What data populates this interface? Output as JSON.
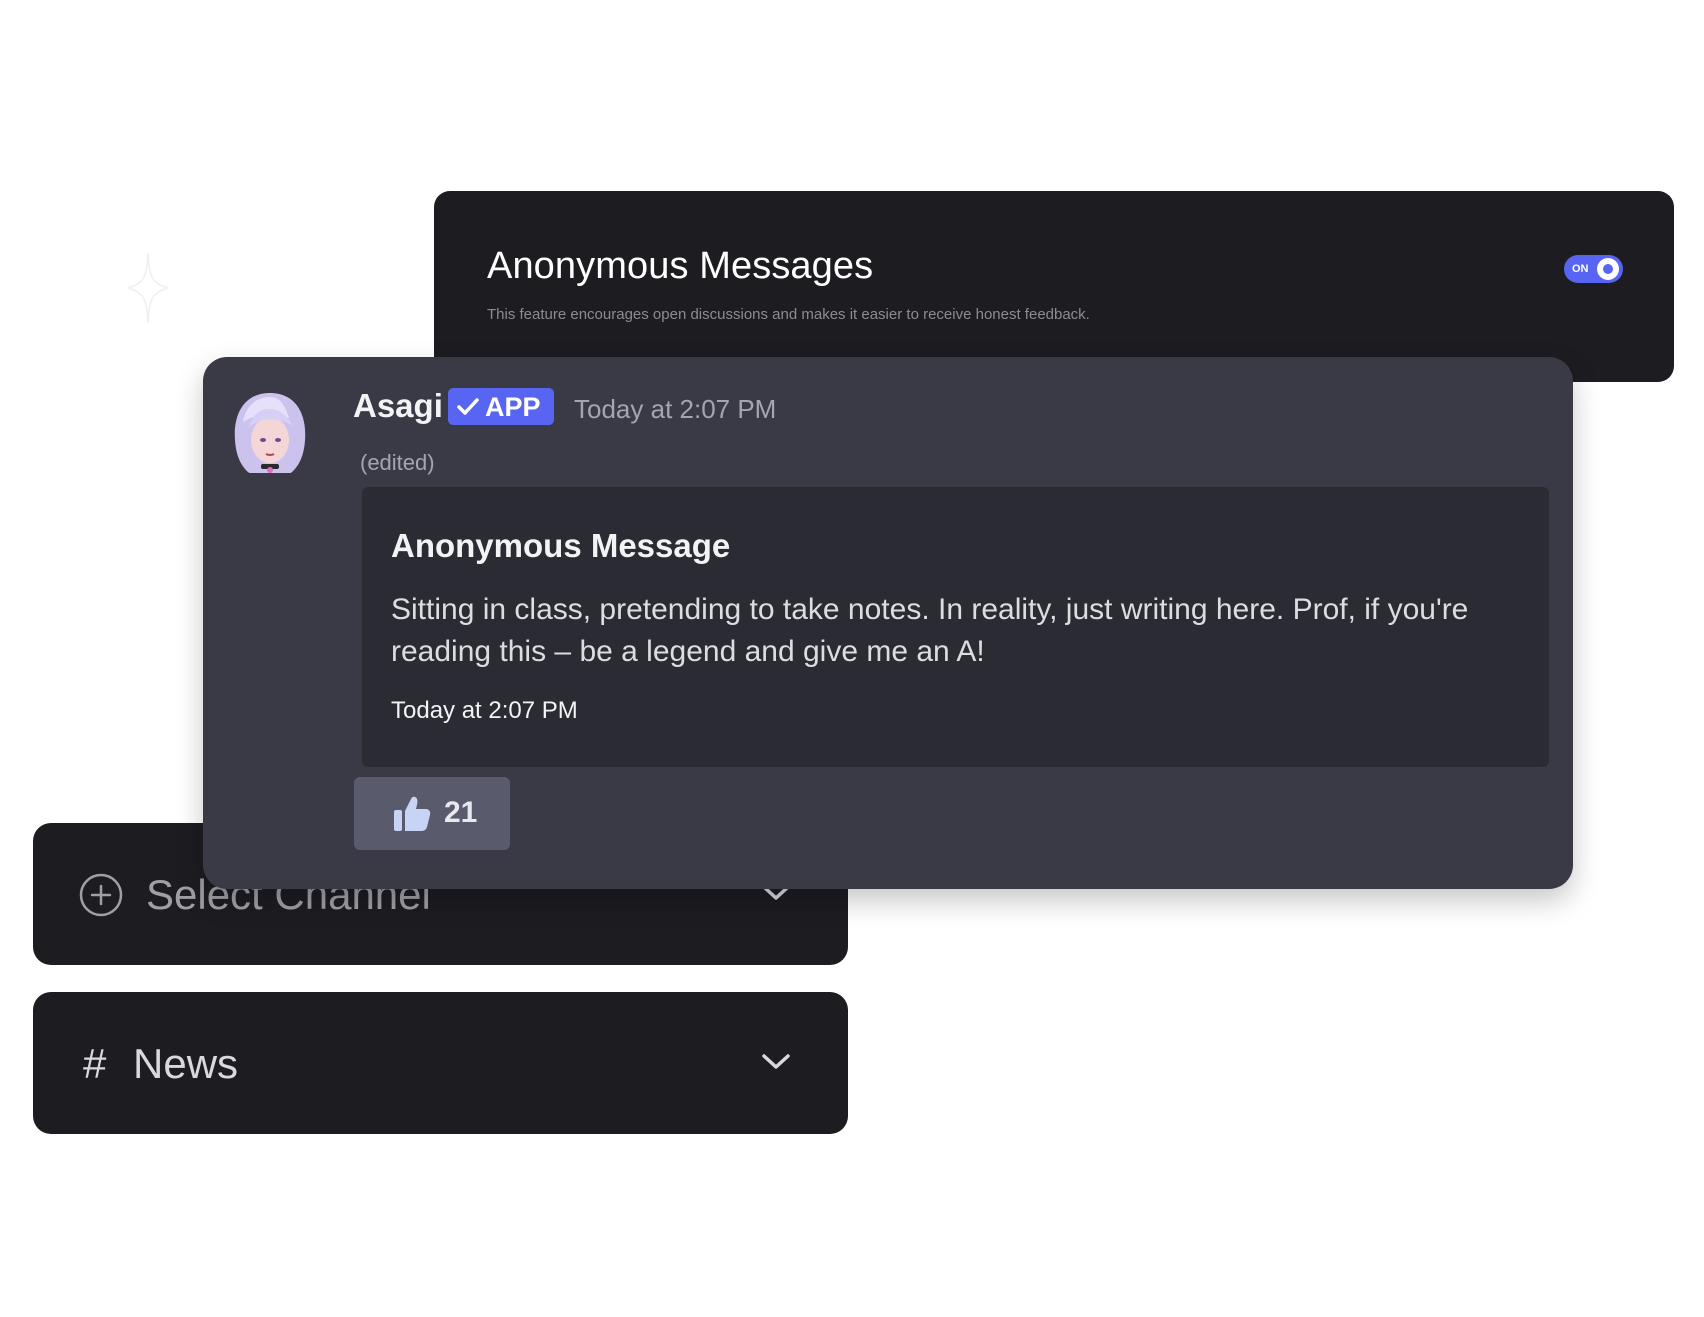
{
  "feature": {
    "title": "Anonymous Messages",
    "description": "This feature encourages open discussions and makes it easier to receive honest feedback.",
    "toggle_label": "ON",
    "toggle_state": "on"
  },
  "message": {
    "username": "Asagi",
    "badge": "APP",
    "timestamp": "Today at 2:07 PM",
    "edited": "(edited)",
    "embed": {
      "title": "Anonymous Message",
      "body": "Sitting in class, pretending to take notes. In reality, just writing here. Prof, if you're reading this – be a legend and give me an A!",
      "footer": "Today at 2:07 PM"
    },
    "reaction": {
      "icon": "thumbs-up-icon",
      "count": "21"
    }
  },
  "dropdowns": {
    "select_channel": {
      "icon": "plus-circle-icon",
      "label": "Select Channel"
    },
    "news": {
      "icon": "hash-icon",
      "prefix": "#",
      "label": "News"
    }
  },
  "colors": {
    "accent": "#5865f2",
    "card_dark": "#1d1c21",
    "message_bg": "#393a45",
    "embed_bg": "#2b2c33",
    "reaction_bg": "#595b6d"
  }
}
